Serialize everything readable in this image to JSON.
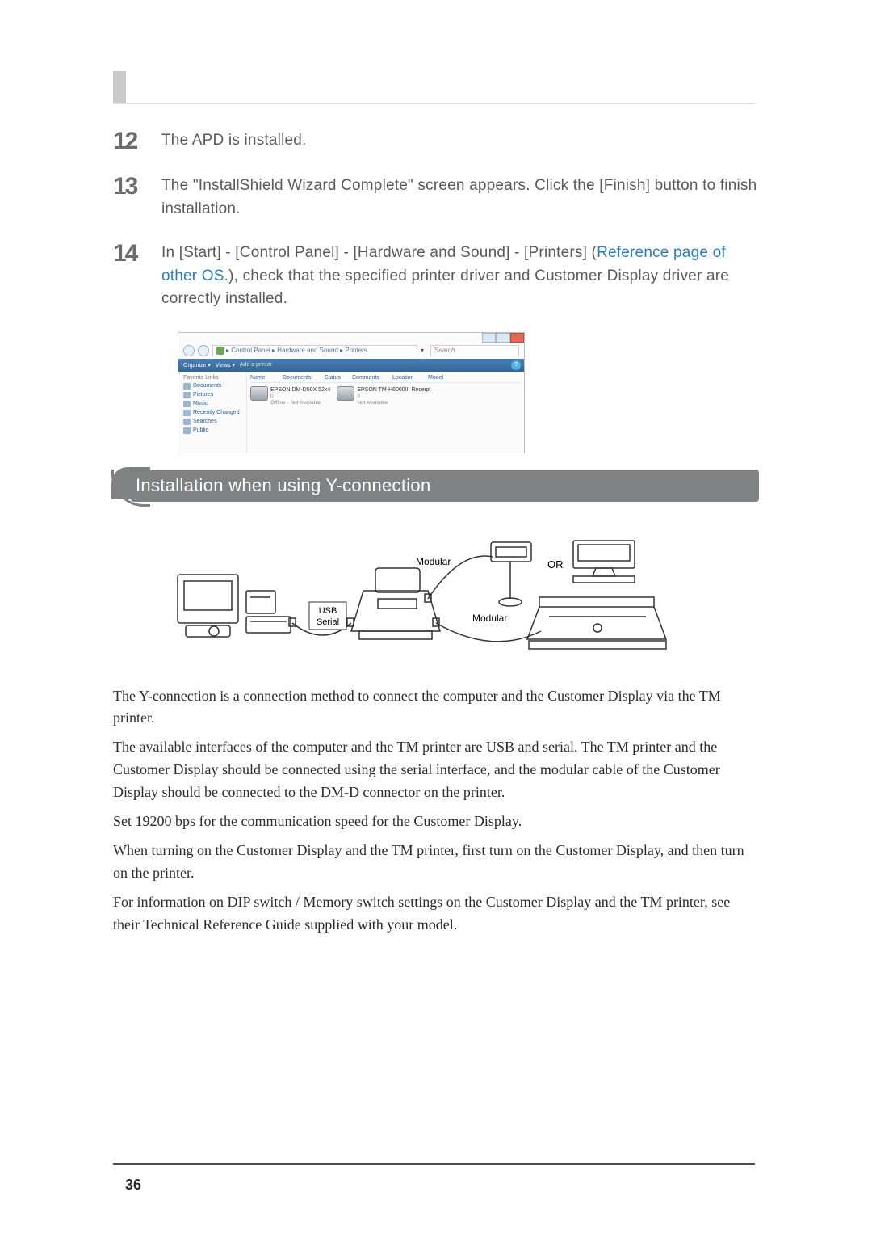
{
  "page_number": "36",
  "steps": [
    {
      "num": "12",
      "text": "The APD is installed."
    },
    {
      "num": "13",
      "text": "The \"InstallShield Wizard Complete\" screen appears. Click the [Finish] button to finish installation."
    },
    {
      "num": "14",
      "before_link": "In [Start] - [Control Panel] - [Hardware and Sound] - [Printers] (",
      "link": "Reference page of other OS.",
      "after_link": "), check that the specified printer driver and Customer Display driver are correctly installed."
    }
  ],
  "screenshot": {
    "breadcrumb": "▸ Control Panel ▸ Hardware and Sound ▸ Printers",
    "search_placeholder": "Search",
    "toolbar_items": [
      "Organize ▾",
      "Views ▾",
      "Add a printer"
    ],
    "sidebar_header": "Favorite Links",
    "sidebar_items": [
      "Documents",
      "Pictures",
      "Music",
      "Recently Changed",
      "Searches",
      "Public"
    ],
    "columns": [
      "Name",
      "Documents",
      "Status",
      "Comments",
      "Location",
      "Model"
    ],
    "printers": [
      {
        "name": "EPSON DM-D50X 52x4",
        "status_line1": "0",
        "status_line2": "Offline - Not Available"
      },
      {
        "name": "EPSON TM-H6000III Receipt",
        "status_line1": "0",
        "status_line2": "Not Available"
      }
    ]
  },
  "section_title": "Installation when using Y-connection",
  "diagram_labels": {
    "modular1": "Modular",
    "modular2": "Modular",
    "usb": "USB",
    "serial": "Serial",
    "or": "OR"
  },
  "paragraphs": [
    "The Y-connection is a connection method to connect the computer and the Customer Display via the TM printer.",
    "The available interfaces of the computer and the TM printer are USB and serial. The TM printer and the Customer Display should be connected using the serial interface, and the modular cable of the Customer Display should be connected to the DM-D connector on the printer.",
    "Set 19200 bps for the communication speed for the Customer Display.",
    "When turning on the Customer Display and the TM printer, first turn on the Customer Display, and then turn on the printer.",
    "For information on DIP switch / Memory switch settings on the Customer Display and the TM printer, see their Technical Reference Guide supplied with your model."
  ]
}
